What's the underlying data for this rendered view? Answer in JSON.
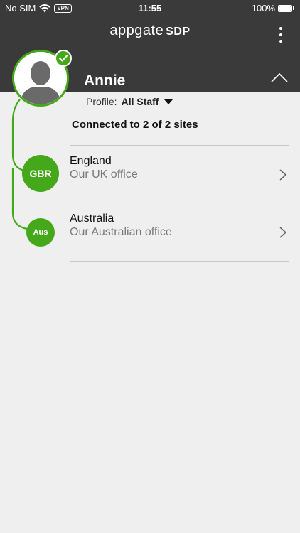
{
  "status_bar": {
    "carrier": "No SIM",
    "vpn": "VPN",
    "time": "11:55",
    "battery": "100%",
    "battery_level": 1.0
  },
  "header": {
    "brand_word": "appgate",
    "brand_suffix": "SDP",
    "user_name": "Annie"
  },
  "profile": {
    "label": "Profile:",
    "value": "All Staff"
  },
  "summary": "Connected to 2 of 2 sites",
  "sites": [
    {
      "badge": "GBR",
      "name": "England",
      "description": "Our UK office"
    },
    {
      "badge": "Aus",
      "name": "Australia",
      "description": "Our Australian office"
    }
  ],
  "colors": {
    "accent_green": "#45a81a",
    "header_bg": "#3a3a3a",
    "page_bg": "#efefef"
  },
  "icons": {
    "wifi": "wifi-icon",
    "battery": "battery-icon",
    "menu": "more-vertical-icon",
    "collapse": "chevron-up-icon",
    "check": "check-icon",
    "avatar": "user-silhouette-icon",
    "dropdown": "caret-down-icon",
    "row": "chevron-right-icon"
  }
}
